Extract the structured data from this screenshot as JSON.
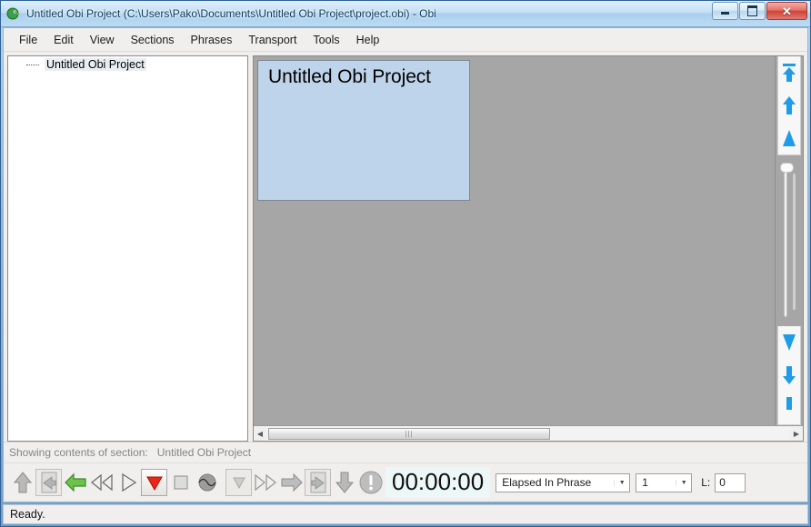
{
  "window": {
    "title": "Untitled Obi Project (C:\\Users\\Pako\\Documents\\Untitled Obi Project\\project.obi) - Obi",
    "app_icon": "obi-app-icon",
    "controls": {
      "minimize": "minimize-button",
      "maximize": "maximize-button",
      "close_label": "✕"
    }
  },
  "menubar": {
    "items": [
      {
        "label": "File"
      },
      {
        "label": "Edit"
      },
      {
        "label": "View"
      },
      {
        "label": "Sections"
      },
      {
        "label": "Phrases"
      },
      {
        "label": "Transport"
      },
      {
        "label": "Tools"
      },
      {
        "label": "Help"
      }
    ]
  },
  "tree": {
    "nodes": [
      {
        "label": "Untitled Obi Project",
        "selected": true
      }
    ]
  },
  "content": {
    "section": {
      "title": "Untitled Obi Project",
      "fill_color": "#bed4ea",
      "border_color": "#7d8893"
    },
    "footer": {
      "label": "Showing contents of section:",
      "value": "Untitled Obi Project"
    },
    "hscroll": {
      "left_arrow": "◀",
      "right_arrow": "▶",
      "thumb_grip": "|||"
    },
    "vertical_strip": {
      "top_buttons": [
        {
          "name": "go-to-top-icon"
        },
        {
          "name": "move-up-icon"
        },
        {
          "name": "increase-icon"
        }
      ],
      "bottom_buttons": [
        {
          "name": "decrease-icon"
        },
        {
          "name": "move-down-icon"
        },
        {
          "name": "go-to-bottom-icon"
        }
      ],
      "accent_color": "#1e9ce8"
    }
  },
  "transport": {
    "buttons": [
      {
        "name": "previous-section-up-arrow",
        "glyph": "arrow-up",
        "state": "enabled"
      },
      {
        "name": "previous-page-button",
        "glyph": "page-left",
        "state": "disabled"
      },
      {
        "name": "previous-phrase-button",
        "glyph": "arrow-left-green",
        "state": "enabled"
      },
      {
        "name": "rewind-button",
        "glyph": "rewind",
        "state": "enabled"
      },
      {
        "name": "play-button",
        "glyph": "play",
        "state": "enabled"
      },
      {
        "name": "record-button",
        "glyph": "record",
        "state": "enabled"
      },
      {
        "name": "stop-button",
        "glyph": "stop",
        "state": "enabled"
      },
      {
        "name": "monitor-button",
        "glyph": "waveform",
        "state": "enabled"
      },
      {
        "name": "next-phrase-down-button",
        "glyph": "triangle-down-boxed",
        "state": "disabled"
      },
      {
        "name": "fast-forward-button",
        "glyph": "fast-forward",
        "state": "enabled"
      },
      {
        "name": "next-phrase-button",
        "glyph": "arrow-right",
        "state": "enabled"
      },
      {
        "name": "next-page-button",
        "glyph": "page-right",
        "state": "enabled"
      },
      {
        "name": "next-section-down-arrow",
        "glyph": "arrow-down",
        "state": "enabled"
      },
      {
        "name": "status-indicator-icon",
        "glyph": "exclamation-circle",
        "state": "enabled"
      }
    ],
    "time_display": "00:00:00",
    "mode_select": {
      "value": "Elapsed In Phrase",
      "arrow": "▼"
    },
    "number_select": {
      "value": "1",
      "arrow": "▼"
    },
    "level_label": "L:",
    "level_value": "0"
  },
  "statusbar": {
    "message": "Ready."
  }
}
